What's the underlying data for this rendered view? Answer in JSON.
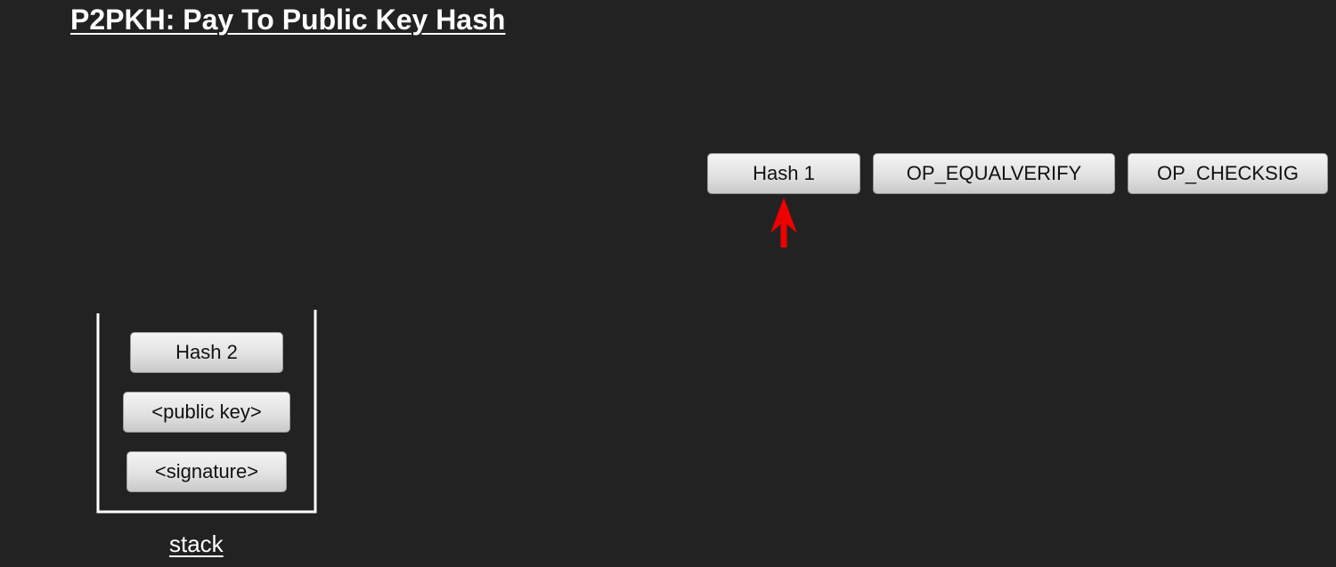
{
  "title": "P2PKH: Pay To Public Key Hash",
  "script": {
    "items": [
      "Hash 1",
      "OP_EQUALVERIFY",
      "OP_CHECKSIG"
    ],
    "pointer_color": "#ee0000"
  },
  "stack": {
    "label": "stack",
    "items": [
      "Hash 2",
      "<public key>",
      "<signature>"
    ]
  }
}
